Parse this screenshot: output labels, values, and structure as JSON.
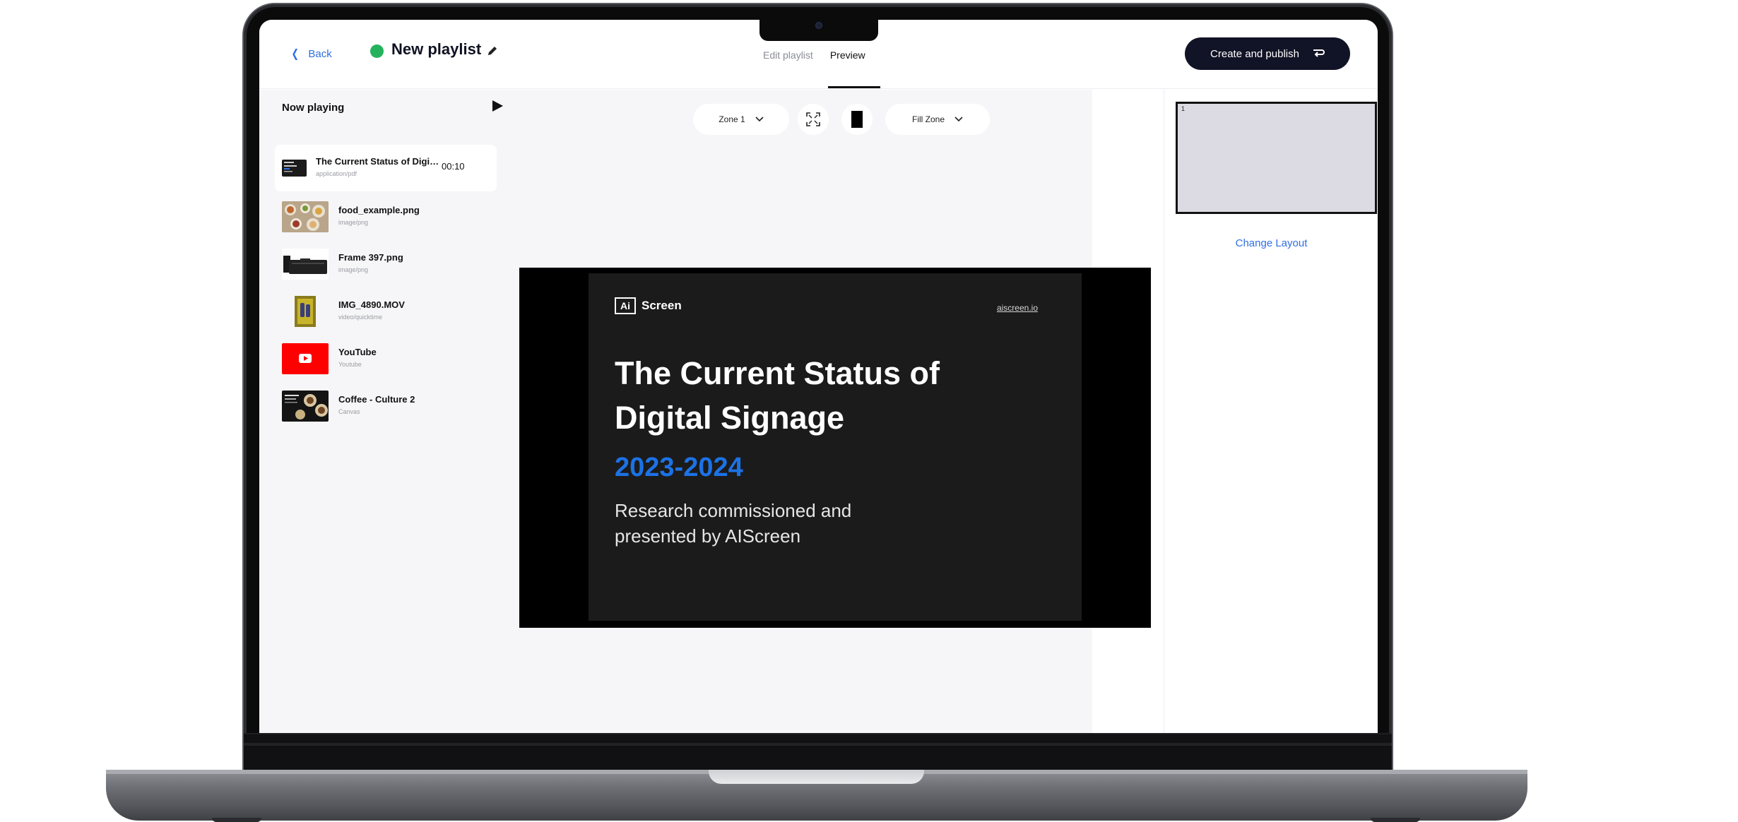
{
  "header": {
    "back_label": "Back",
    "playlist_title": "New playlist",
    "tabs": [
      {
        "label": "Edit playlist",
        "active": false
      },
      {
        "label": "Preview",
        "active": true
      }
    ],
    "publish_label": "Create and publish"
  },
  "now_playing": {
    "title": "Now playing",
    "items": [
      {
        "name": "The Current Status of Digita...",
        "type": "application/pdf",
        "duration": "00:10",
        "active": true,
        "thumb": "pdf-slide"
      },
      {
        "name": "food_example.png",
        "type": "image/png",
        "thumb": "food"
      },
      {
        "name": "Frame 397.png",
        "type": "image/png",
        "thumb": "device"
      },
      {
        "name": "IMG_4890.MOV",
        "type": "video/quicktime",
        "thumb": "product"
      },
      {
        "name": "YouTube",
        "type": "Youtube",
        "thumb": "youtube"
      },
      {
        "name": "Coffee - Culture 2",
        "type": "Canvas",
        "thumb": "coffee"
      }
    ]
  },
  "controls": {
    "zone_select": "Zone 1",
    "fill_select": "Fill Zone"
  },
  "slide": {
    "logo_box": "Ai",
    "logo_text": "Screen",
    "url": "aiscreen.io",
    "title": "The Current Status of Digital Signage",
    "year": "2023-2024",
    "subtitle": "Research commissioned and presented by AIScreen"
  },
  "layout": {
    "zone_number": "1",
    "change_label": "Change Layout"
  },
  "colors": {
    "accent": "#2f6fe4",
    "status_green": "#24b25d",
    "primary_button": "#111326",
    "year_blue": "#1c72e6"
  }
}
